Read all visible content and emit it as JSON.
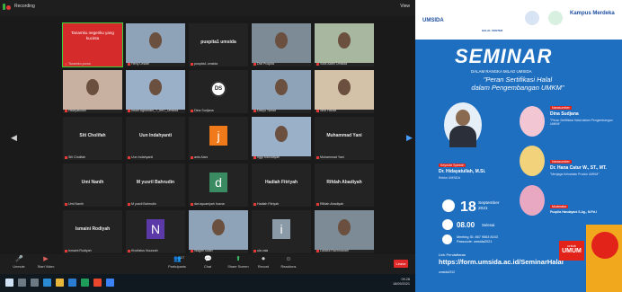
{
  "zoom": {
    "topbar": {
      "recording_label": "Recording",
      "view_label": "View"
    },
    "tiles": [
      {
        "id": "t0",
        "bigname": "",
        "label": "Tanamku ponco",
        "banner": "Tanamku negeriku yang kucinta",
        "kind": "banner"
      },
      {
        "id": "t1",
        "bigname": "",
        "label": "Heny Lestari",
        "kind": "cam"
      },
      {
        "id": "t2",
        "bigname": "puspita1 umsida",
        "label": "puspita1 umsida",
        "kind": "text"
      },
      {
        "id": "t3",
        "bigname": "",
        "label": "Dwi Puspita",
        "kind": "cam"
      },
      {
        "id": "t4",
        "bigname": "",
        "label": "Sofa Aldini Umsida",
        "kind": "cam"
      },
      {
        "id": "t5",
        "bigname": "",
        "label": "Hidayatullah",
        "kind": "cam"
      },
      {
        "id": "t6",
        "bigname": "",
        "label": "Insan Agromani_T_mrC_Umsida",
        "kind": "cam"
      },
      {
        "id": "t7",
        "bigname": "",
        "label": "Dina Sudjana",
        "letter": "DS",
        "kind": "ds"
      },
      {
        "id": "t8",
        "bigname": "",
        "label": "Didiyo Tamar",
        "kind": "cam"
      },
      {
        "id": "t9",
        "bigname": "",
        "label": "Widi Hanafi",
        "kind": "cam"
      },
      {
        "id": "t10",
        "bigname": "Siti Cholifah",
        "label": "Siti Cholifah",
        "kind": "text"
      },
      {
        "id": "t11",
        "bigname": "Uun Indahyanti",
        "label": "Uun Indahyanti",
        "kind": "text"
      },
      {
        "id": "t12",
        "bigname": "",
        "label": "anis Alani",
        "letter": "j",
        "kind": "letter",
        "bg": "#f07a1a"
      },
      {
        "id": "t13",
        "bigname": "",
        "label": "nggi Marvaliyah",
        "kind": "cam"
      },
      {
        "id": "t14",
        "bigname": "Muhammad Yani",
        "label": "Muhammad Yani",
        "kind": "text"
      },
      {
        "id": "t15",
        "bigname": "Umi Nanih",
        "label": "Umi Nanih",
        "kind": "text"
      },
      {
        "id": "t16",
        "bigname": "M yusril Bahrudin",
        "label": "M yusril Bahrudin",
        "kind": "text"
      },
      {
        "id": "t17",
        "bigname": "",
        "label": "dwi ayuaniyah husna",
        "letter": "d",
        "kind": "letter",
        "bg": "#3a8a62"
      },
      {
        "id": "t18",
        "bigname": "Hadiah Fitriyah",
        "label": "Hadiah Fitriyah",
        "kind": "text"
      },
      {
        "id": "t19",
        "bigname": "Rifdah Abadiyah",
        "label": "Rifdah Abadiyah",
        "kind": "text"
      },
      {
        "id": "t20",
        "bigname": "Ismaini Rodiyah",
        "label": "Ismaini Rodiyah",
        "kind": "text"
      },
      {
        "id": "t21",
        "bigname": "",
        "label": "Khoifatus Nuurzah",
        "letter": "N",
        "kind": "letter",
        "bg": "#5b3aa8"
      },
      {
        "id": "t22",
        "bigname": "",
        "label": "Wagith solah",
        "kind": "cam"
      },
      {
        "id": "t23",
        "bigname": "",
        "label": "ula vaia",
        "letter": "i",
        "kind": "letter",
        "bg": "#8a9aa6"
      },
      {
        "id": "t24",
        "bigname": "",
        "label": "Lailatul Rachmanah",
        "kind": "cam"
      }
    ],
    "toolbar": [
      {
        "name": "unmute",
        "label": "Unmute",
        "icon": "🎤"
      },
      {
        "name": "start-video",
        "label": "Start Video",
        "icon": "▶"
      },
      {
        "name": "participants",
        "label": "Participants",
        "icon": "👥",
        "count": "27"
      },
      {
        "name": "chat",
        "label": "Chat",
        "icon": "💬"
      },
      {
        "name": "share-screen",
        "label": "Share Screen",
        "icon": "⬆"
      },
      {
        "name": "record",
        "label": "Record",
        "icon": "⏺"
      },
      {
        "name": "reactions",
        "label": "Reactions",
        "icon": "☺"
      }
    ],
    "leave_label": "Leave",
    "taskbar": {
      "time": "09.28",
      "date": "18/09/2021"
    }
  },
  "poster": {
    "logos": [
      "UMSIDA",
      "HALAL CENTER",
      "Kampus Merdeka"
    ],
    "title": "SEMINAR",
    "subtitle": "DALAM RANGKA MILAD UMSIDA",
    "topic_line1": "\"Peran Sertifikasi Halal",
    "topic_line2": "dalam Pengembangan UMKM\"",
    "keynote_tag": "Keynote Speech",
    "keynote_name": "Dr. Hidayatullah, M.Si.",
    "keynote_desc": "Rektor UMSIDA",
    "speaker1_tag": "Narasumber",
    "speaker1_name": "Dina Sudjana",
    "speaker1_desc": "\"Peran Sertifikasi Halal dalam Pengembangan UMKM\"",
    "speaker2_tag": "Narasumber",
    "speaker2_name": "Dr. Hana Catur W., ST., MT.",
    "speaker2_desc": "\"Menjaga Kehalalan Produk UMKM\"",
    "moderator_tag": "Moderator",
    "moderator_name": "Puspita Handayani S.Ag., M.Pd.I",
    "date_num": "18",
    "date_month": "September",
    "date_year": "2021",
    "time": "08.00",
    "time_zone": "Selesai",
    "zoom_info": "Meeting ID: 867 9563 8153\nPasscode: umsida2021",
    "reg_label": "Link Pendaftaran",
    "reg_url": "https://form.umsida.ac.id/SeminarHalal",
    "untuk_a": "untuk",
    "untuk_b": "UMUM",
    "social": "umsida1912"
  }
}
